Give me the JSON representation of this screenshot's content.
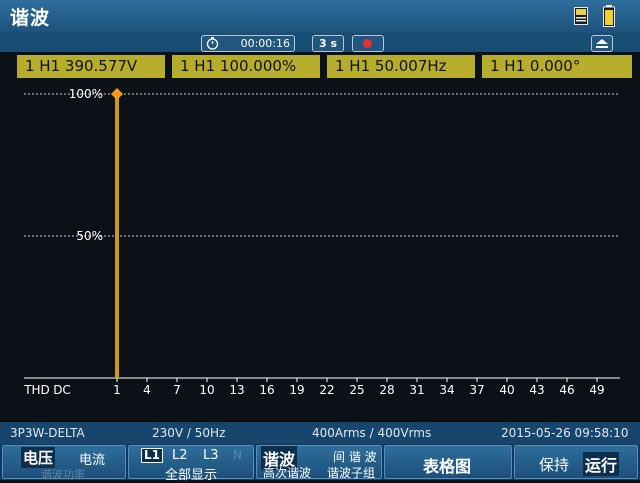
{
  "header": {
    "title": "谐波"
  },
  "status": {
    "elapsed": "00:00:16",
    "interval": "3 s"
  },
  "readouts": [
    "1 H1  390.577V",
    "1 H1  100.000%",
    "1 H1  50.007Hz",
    "1 H1  0.000°"
  ],
  "chart_data": {
    "type": "bar",
    "ylabels": [
      "100%",
      "50%"
    ],
    "xlabels": [
      "THD",
      "DC",
      "1",
      "4",
      "7",
      "10",
      "13",
      "16",
      "19",
      "22",
      "25",
      "28",
      "31",
      "34",
      "37",
      "40",
      "43",
      "46",
      "49"
    ],
    "bars": [
      {
        "harmonic": "1",
        "value": 100
      }
    ],
    "cursor_harmonic": "1",
    "ylim": [
      0,
      110
    ],
    "grid": "dotted",
    "colors": {
      "bar": "#c99a1e",
      "cursor": "#f29a1a",
      "grid": "#c8ccd2",
      "axis": "#ffffff"
    }
  },
  "info": {
    "wiring": "3P3W-DELTA",
    "nominal": "230V / 50Hz",
    "range": "400Arms / 400Vrms",
    "datetime": "2015-05-26 09:58:10"
  },
  "softkeys": {
    "k1": {
      "a": "电压",
      "b": "电流",
      "c": "谐波功率"
    },
    "k2": {
      "l1": "L1",
      "l2": "L2",
      "l3": "L3",
      "n": "N",
      "sub": "全部显示"
    },
    "k3": {
      "a": "谐波",
      "b": "高次谐波"
    },
    "k4": {
      "a": "间 谐 波",
      "b": "谐波子组"
    },
    "k5": {
      "a": "表格图"
    },
    "k6": {
      "a": "保持",
      "b": "运行"
    }
  },
  "icons": {
    "sd": "sd-card-icon",
    "battery": "battery-icon",
    "timer": "stopwatch-icon",
    "record": "record-icon",
    "eject": "eject-icon"
  }
}
